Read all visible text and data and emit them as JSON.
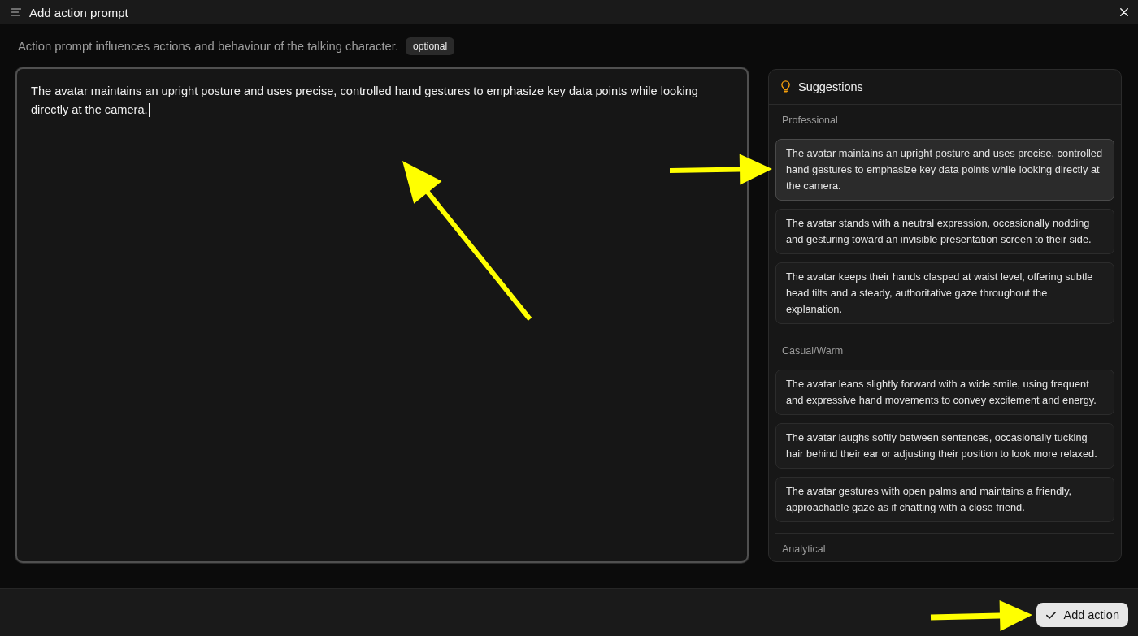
{
  "window": {
    "title": "Add action prompt"
  },
  "description": {
    "text": "Action prompt influences actions and behaviour of the talking character.",
    "tag": "optional"
  },
  "prompt": {
    "value": "The avatar maintains an upright posture and uses precise, controlled hand gestures to emphasize key data points while looking directly at the camera.",
    "focused": true
  },
  "suggestions": {
    "title": "Suggestions",
    "groups": [
      {
        "label": "Professional",
        "items": [
          {
            "text": "The avatar maintains an upright posture and uses precise, controlled hand gestures to emphasize key data points while looking directly at the camera.",
            "selected": true
          },
          {
            "text": "The avatar stands with a neutral expression, occasionally nodding and gesturing toward an invisible presentation screen to their side.",
            "selected": false
          },
          {
            "text": "The avatar keeps their hands clasped at waist level, offering subtle head tilts and a steady, authoritative gaze throughout the explanation.",
            "selected": false
          }
        ]
      },
      {
        "label": "Casual/Warm",
        "items": [
          {
            "text": "The avatar leans slightly forward with a wide smile, using frequent and expressive hand movements to convey excitement and energy.",
            "selected": false
          },
          {
            "text": "The avatar laughs softly between sentences, occasionally tucking hair behind their ear or adjusting their position to look more relaxed.",
            "selected": false
          },
          {
            "text": "The avatar gestures with open palms and maintains a friendly, approachable gaze as if chatting with a close friend.",
            "selected": false
          }
        ]
      },
      {
        "label": "Analytical"
      }
    ]
  },
  "footer": {
    "button": "Add action"
  }
}
